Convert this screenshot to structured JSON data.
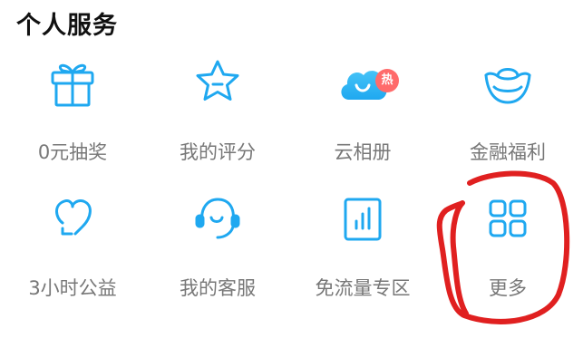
{
  "section": {
    "title": "个人服务"
  },
  "services": [
    {
      "label": "0元抽奖",
      "icon": "gift-icon"
    },
    {
      "label": "我的评分",
      "icon": "star-icon"
    },
    {
      "label": "云相册",
      "icon": "cloud-icon",
      "badge": "热"
    },
    {
      "label": "金融福利",
      "icon": "gold-ingot-icon"
    },
    {
      "label": "3小时公益",
      "icon": "heart-icon"
    },
    {
      "label": "我的客服",
      "icon": "headset-icon"
    },
    {
      "label": "免流量专区",
      "icon": "data-chart-icon"
    },
    {
      "label": "更多",
      "icon": "grid-icon"
    }
  ],
  "colors": {
    "accent": "#1fa8f0",
    "accent_light": "#45c3f7",
    "badge": "#ff6b6b",
    "annotation": "#e02020"
  }
}
